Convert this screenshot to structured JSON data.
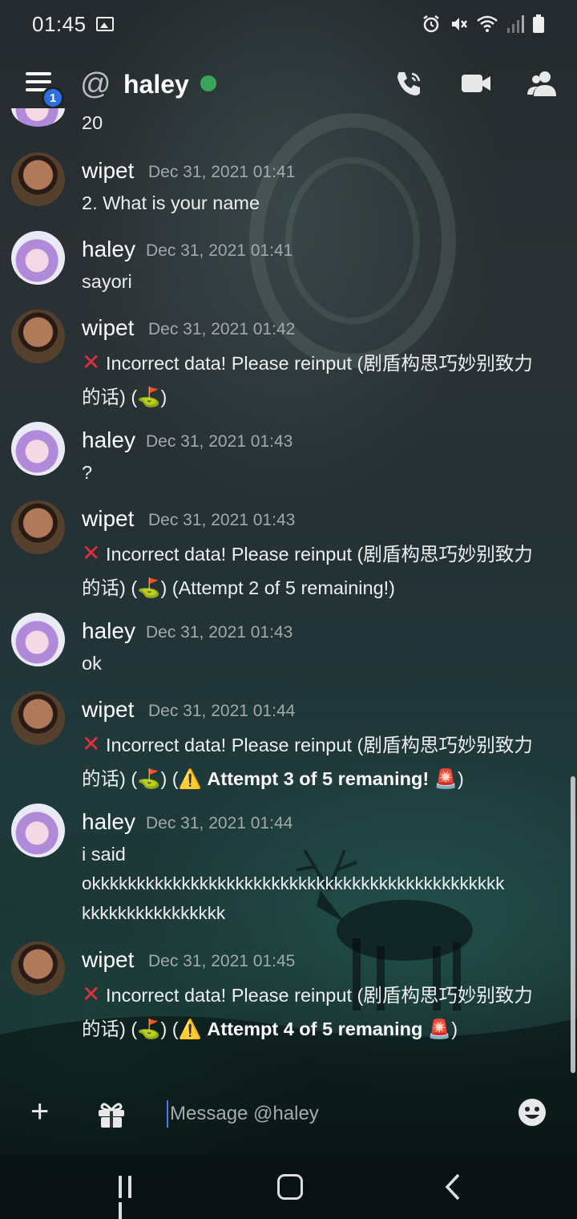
{
  "status_bar": {
    "time": "01:45"
  },
  "header": {
    "notification_count": "1",
    "at_symbol": "@",
    "channel_name": "haley",
    "status_color": "#3ba55c"
  },
  "partial_message": {
    "text": "20"
  },
  "messages": [
    {
      "author": "wipet",
      "timestamp": "Dec 31, 2021 01:41",
      "lines": [
        "2. What is your name"
      ]
    },
    {
      "author": "haley",
      "timestamp": "Dec 31, 2021 01:41",
      "lines": [
        "sayori"
      ]
    },
    {
      "author": "wipet",
      "timestamp": "Dec 31, 2021 01:42",
      "line1": "Incorrect data! Please reinput (剧盾构思巧妙别致力",
      "line2": "的话) (⛳)"
    },
    {
      "author": "haley",
      "timestamp": "Dec 31, 2021 01:43",
      "lines": [
        "?"
      ]
    },
    {
      "author": "wipet",
      "timestamp": "Dec 31, 2021 01:43",
      "line1": "Incorrect data! Please reinput (剧盾构思巧妙别致力",
      "line2": "的话) (⛳) (Attempt 2 of 5 remaining!)"
    },
    {
      "author": "haley",
      "timestamp": "Dec 31, 2021 01:43",
      "lines": [
        "ok"
      ]
    },
    {
      "author": "wipet",
      "timestamp": "Dec 31, 2021 01:44",
      "line1": "Incorrect data! Please reinput (剧盾构思巧妙别致力",
      "line2_prefix": "的话) (⛳) (",
      "line2_bold": "⚠️ Attempt 3 of 5 remaning! 🚨",
      "line2_suffix": ")"
    },
    {
      "author": "haley",
      "timestamp": "Dec 31, 2021 01:44",
      "lines": [
        "i said",
        "okkkkkkkkkkkkkkkkkkkkkkkkkkkkkkkkkkkkkkkkkkkkkk",
        "kkkkkkkkkkkkkkkk"
      ]
    },
    {
      "author": "wipet",
      "timestamp": "Dec 31, 2021 01:45",
      "line1": "Incorrect data! Please reinput (剧盾构思巧妙别致力",
      "line2_prefix": "的话) (⛳) (",
      "line2_bold": "⚠️ Attempt 4 of 5 remaning 🚨",
      "line2_suffix": ")"
    }
  ],
  "icons": {
    "error": "cross-mark-icon"
  },
  "composer": {
    "placeholder": "Message @haley"
  }
}
